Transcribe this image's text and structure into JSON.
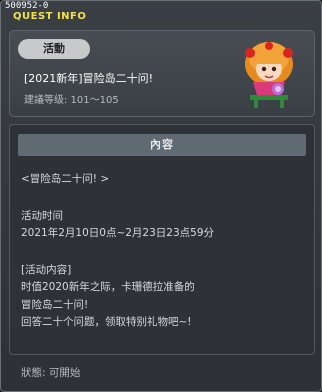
{
  "window": {
    "quest_id": "500952-0",
    "title": "QUEST INFO"
  },
  "header": {
    "badge": "活動",
    "quest_name": "[2021新年]冒险岛二十问!",
    "level": "建議等级: 101～105"
  },
  "content": {
    "heading": "內容",
    "lines": [
      "<冒险岛二十问! >",
      "活动时间",
      "2021年2月10日0点~2月23日23点59分",
      "[活动内容]",
      "时值2020新年之际，卡珊德拉准备的",
      "冒险岛二十问!",
      "回答二十个问题，领取特别礼物吧~!"
    ]
  },
  "footer": {
    "status": "狀態:  可開始"
  }
}
